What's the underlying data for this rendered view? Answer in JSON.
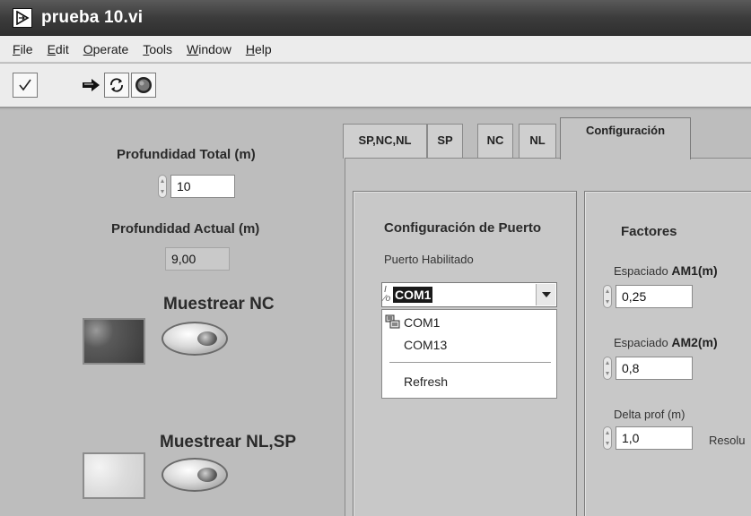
{
  "window": {
    "title": "prueba 10.vi"
  },
  "menu": {
    "items": [
      {
        "label": "File",
        "accel": "F",
        "rest": "ile"
      },
      {
        "label": "Edit",
        "accel": "E",
        "rest": "dit"
      },
      {
        "label": "Operate",
        "accel": "O",
        "rest": "perate"
      },
      {
        "label": "Tools",
        "accel": "T",
        "rest": "ools"
      },
      {
        "label": "Window",
        "accel": "W",
        "rest": "indow"
      },
      {
        "label": "Help",
        "accel": "H",
        "rest": "elp"
      }
    ]
  },
  "toolbar": {
    "icons": [
      "checkmark-icon",
      "run-arrow-icon",
      "run-continuously-icon",
      "abort-stop-icon"
    ]
  },
  "left": {
    "profundidad_total": {
      "label": "Profundidad Total (m)",
      "value": "10"
    },
    "profundidad_actual": {
      "label": "Profundidad Actual (m)",
      "value": "9,00"
    },
    "muestrear_nc": {
      "label": "Muestrear NC"
    },
    "muestrear_nl_sp": {
      "label": "Muestrear NL,SP"
    }
  },
  "tabs": [
    {
      "label": "SP,NC,NL"
    },
    {
      "label": "SP"
    },
    {
      "label": "NC"
    },
    {
      "label": "NL"
    },
    {
      "label": "Configuración",
      "active": true
    }
  ],
  "config": {
    "puerto": {
      "title": "Configuración de Puerto",
      "field_label": "Puerto Habilitado",
      "io_prefix": "I/O",
      "selected": "COM1",
      "options": [
        "COM1",
        "COM13"
      ],
      "refresh": "Refresh"
    },
    "factores": {
      "title": "Factores",
      "am1": {
        "label_prefix": "Espaciado ",
        "label_bold": "AM1(m)",
        "value": "0,25"
      },
      "am2": {
        "label_prefix": "Espaciado ",
        "label_bold": "AM2(m)",
        "value": "0,8"
      },
      "delta": {
        "label": "Delta prof (m)",
        "value": "1,0"
      },
      "resolucion": {
        "label": "Resolu"
      }
    }
  }
}
